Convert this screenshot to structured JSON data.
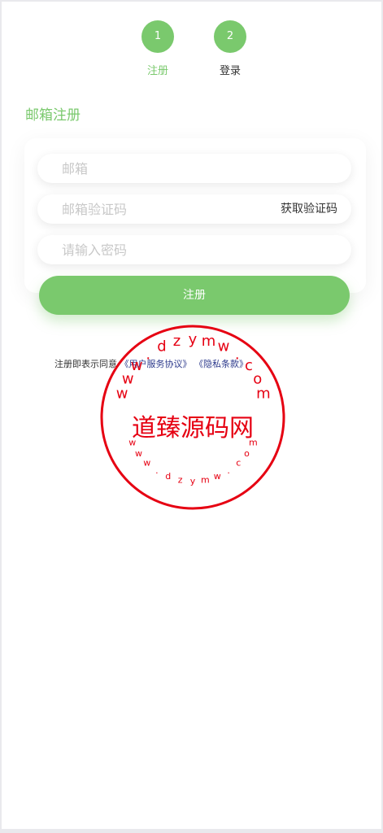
{
  "steps": [
    {
      "number": "1",
      "label": "注册"
    },
    {
      "number": "2",
      "label": "登录"
    }
  ],
  "section_title": "邮箱注册",
  "form": {
    "email_placeholder": "邮箱",
    "code_placeholder": "邮箱验证码",
    "get_code_label": "获取验证码",
    "password_placeholder": "请输入密码",
    "submit_label": "注册"
  },
  "agreement": {
    "prefix": "注册即表示同意",
    "user_agreement": "《用户服务协议》",
    "privacy_policy": "《隐私条款》"
  },
  "watermark": {
    "center_text": "道臻源码网",
    "ring_top": [
      "w",
      "w",
      "w",
      ".",
      "d",
      "z",
      "y",
      "m",
      "w",
      ".",
      "c",
      "o",
      "m"
    ],
    "ring_bottom": [
      "w",
      "w",
      "w",
      ".",
      "d",
      "z",
      "y",
      "m",
      "w",
      ".",
      "c",
      "o",
      "m"
    ],
    "color": "#e60012"
  },
  "colors": {
    "accent": "#7ac96d",
    "link": "#2d3a8c"
  }
}
